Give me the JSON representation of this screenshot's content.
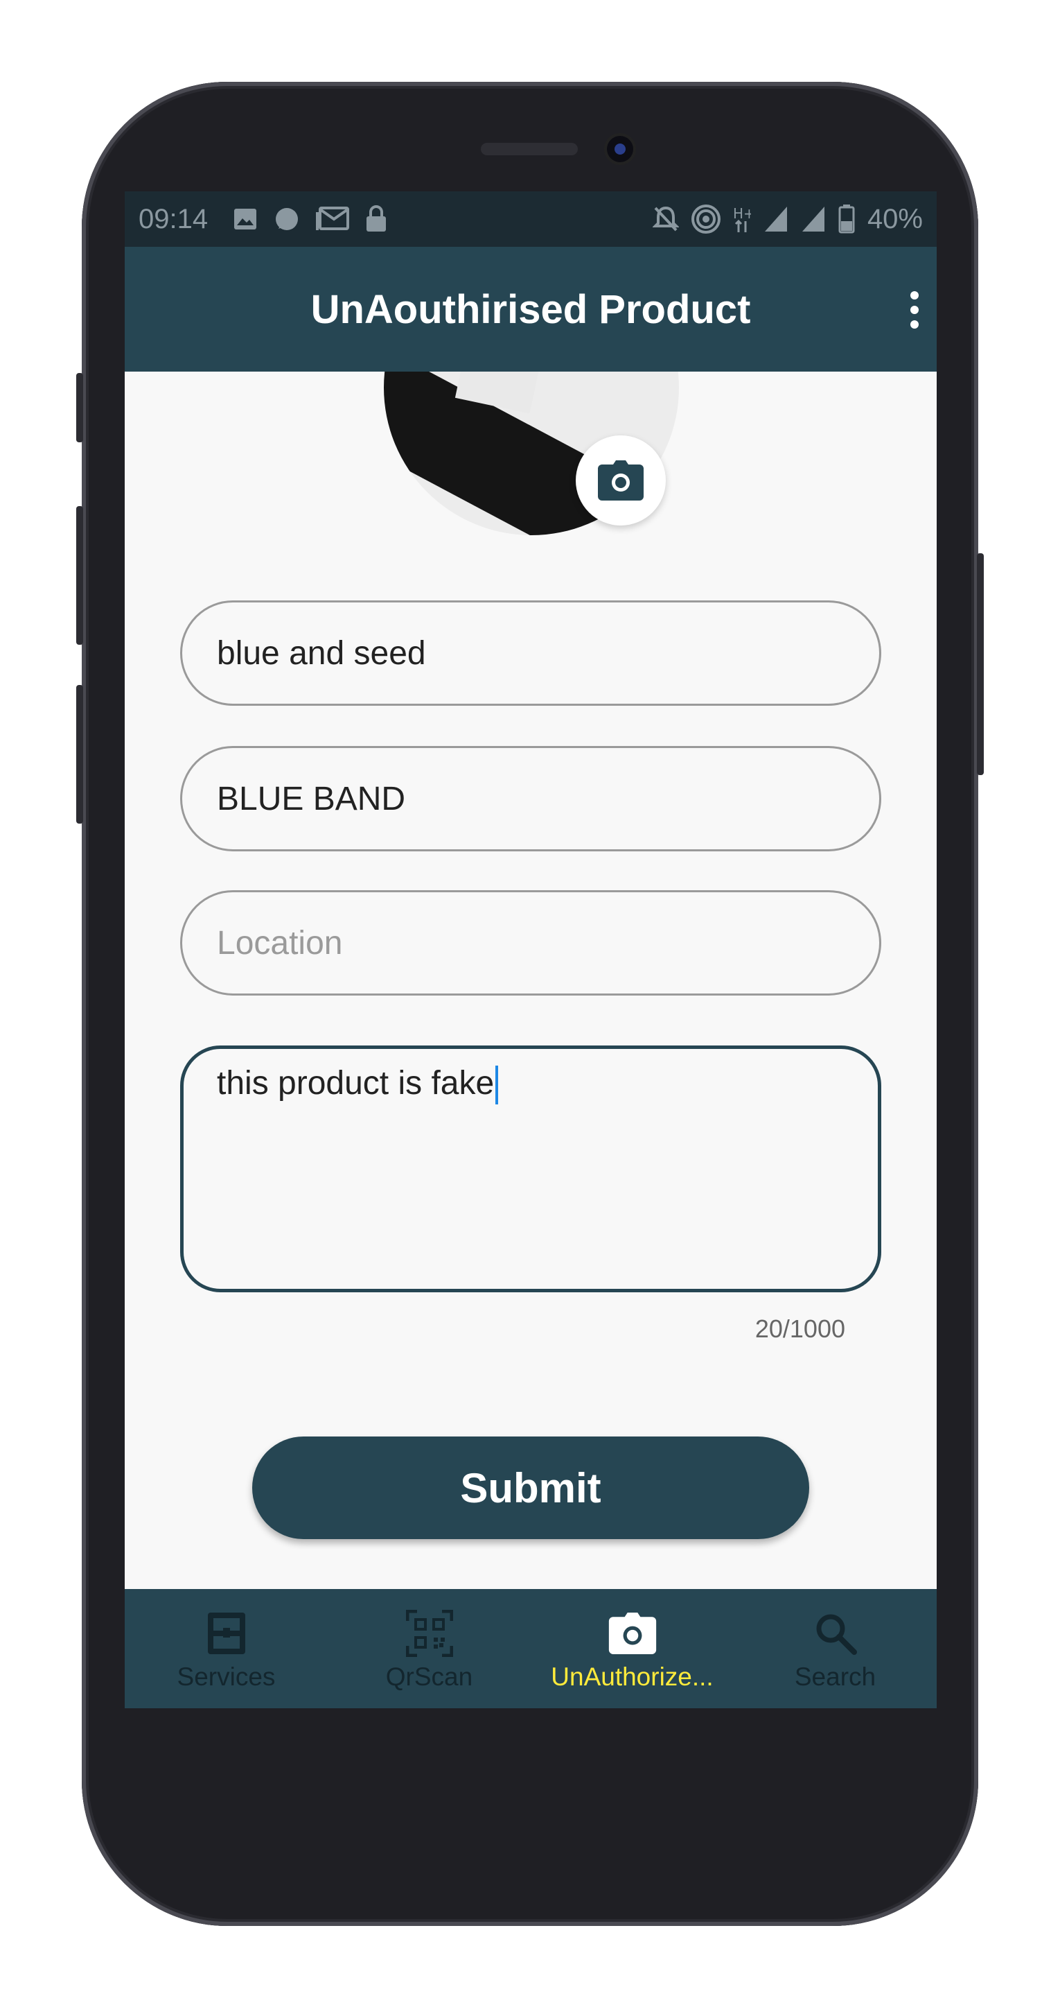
{
  "status_bar": {
    "time": "09:14",
    "battery": "40%",
    "icons_left": [
      "image-icon",
      "chat-icon",
      "mail-icon",
      "lock-icon"
    ],
    "icons_right": [
      "mute-icon",
      "hotspot-icon",
      "network-h-icon",
      "signal-icon",
      "signal-icon",
      "battery-icon"
    ]
  },
  "app_bar": {
    "title": "UnAouthirised Product",
    "menu_icon": "more-vert-icon"
  },
  "form": {
    "photo_button_icon": "camera-icon",
    "product_name_value": "blue and seed",
    "brand_value": "BLUE BAND",
    "location_placeholder": "Location",
    "description_value": "this product is fake",
    "char_counter": "20/1000",
    "submit_label": "Submit"
  },
  "bottom_nav": {
    "items": [
      {
        "label": "Services",
        "icon": "services-icon",
        "active": false
      },
      {
        "label": "QrScan",
        "icon": "qr-code-icon",
        "active": false
      },
      {
        "label": "UnAuthorize...",
        "icon": "camera-icon",
        "active": true
      },
      {
        "label": "Search",
        "icon": "search-icon",
        "active": false
      }
    ],
    "active_color": "#ffeb3b"
  },
  "colors": {
    "primary": "#264653",
    "background": "#f8f8f8"
  }
}
